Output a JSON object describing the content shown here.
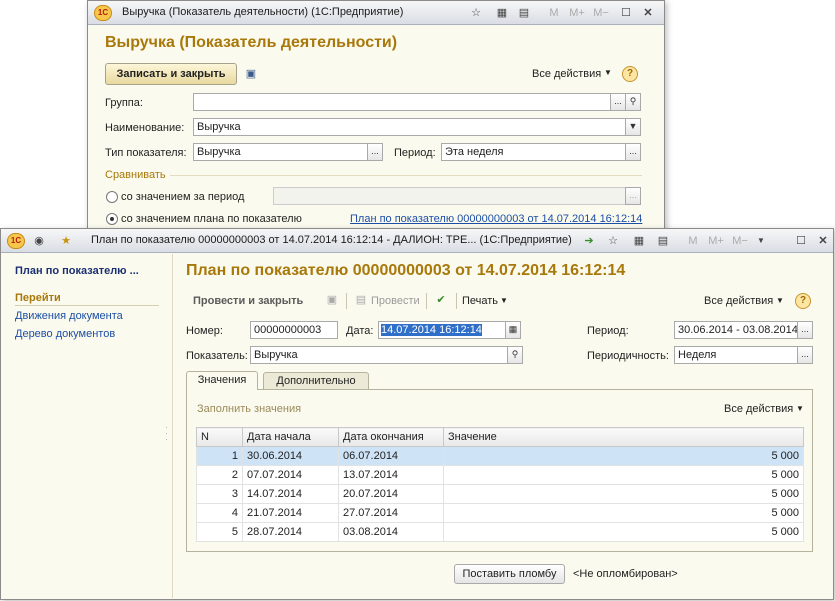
{
  "back_window": {
    "title": "Выручка (Показатель деятельности)  (1С:Предприятие)",
    "heading": "Выручка (Показатель деятельности)",
    "save_close": "Записать и закрыть",
    "all_actions": "Все действия",
    "group_label": "Группа:",
    "group_value": "",
    "name_label": "Наименование:",
    "name_value": "Выручка",
    "type_label": "Тип показателя:",
    "type_value": "Выручка",
    "period_label": "Период:",
    "period_value": "Эта неделя",
    "compare_label": "Сравнивать",
    "radio1": "со значением за период",
    "radio2": "со значением плана по показателю",
    "plan_link": "План по показателю 00000000003 от 14.07.2014 16:12:14",
    "title_buttons": [
      "M",
      "M+",
      "M−"
    ]
  },
  "front_window": {
    "title": "План по показателю 00000000003 от 14.07.2014 16:12:14 - ДАЛИОН: ТРЕ...  (1С:Предприятие)",
    "sidebar_title": "План по показателю ...",
    "sidebar_goto": "Перейти",
    "sidebar_links": [
      "Движения документа",
      "Дерево документов"
    ],
    "heading": "План по показателю 00000000003 от 14.07.2014 16:12:14",
    "post_close": "Провести и закрыть",
    "post": "Провести",
    "print": "Печать",
    "all_actions": "Все действия",
    "number_label": "Номер:",
    "number_value": "00000000003",
    "date_label": "Дата:",
    "date_value": "14.07.2014 16:12:14",
    "period_label": "Период:",
    "period_value": "30.06.2014 - 03.08.2014",
    "indicator_label": "Показатель:",
    "indicator_value": "Выручка",
    "periodicity_label": "Периодичность:",
    "periodicity_value": "Неделя",
    "tabs": [
      "Значения",
      "Дополнительно"
    ],
    "fill_values": "Заполнить значения",
    "table_all_actions": "Все действия",
    "columns": [
      "N",
      "Дата начала",
      "Дата окончания",
      "Значение"
    ],
    "rows": [
      {
        "n": "1",
        "start": "30.06.2014",
        "end": "06.07.2014",
        "value": "5 000"
      },
      {
        "n": "2",
        "start": "07.07.2014",
        "end": "13.07.2014",
        "value": "5 000"
      },
      {
        "n": "3",
        "start": "14.07.2014",
        "end": "20.07.2014",
        "value": "5 000"
      },
      {
        "n": "4",
        "start": "21.07.2014",
        "end": "27.07.2014",
        "value": "5 000"
      },
      {
        "n": "5",
        "start": "28.07.2014",
        "end": "03.08.2014",
        "value": "5 000"
      }
    ],
    "seal_button": "Поставить пломбу",
    "seal_status": "<Не опломбирован>",
    "title_buttons": [
      "M",
      "M+",
      "M−"
    ]
  },
  "colors": {
    "heading": "#a8780a",
    "link": "#1c4fa5",
    "selection": "#cfe3f6"
  }
}
